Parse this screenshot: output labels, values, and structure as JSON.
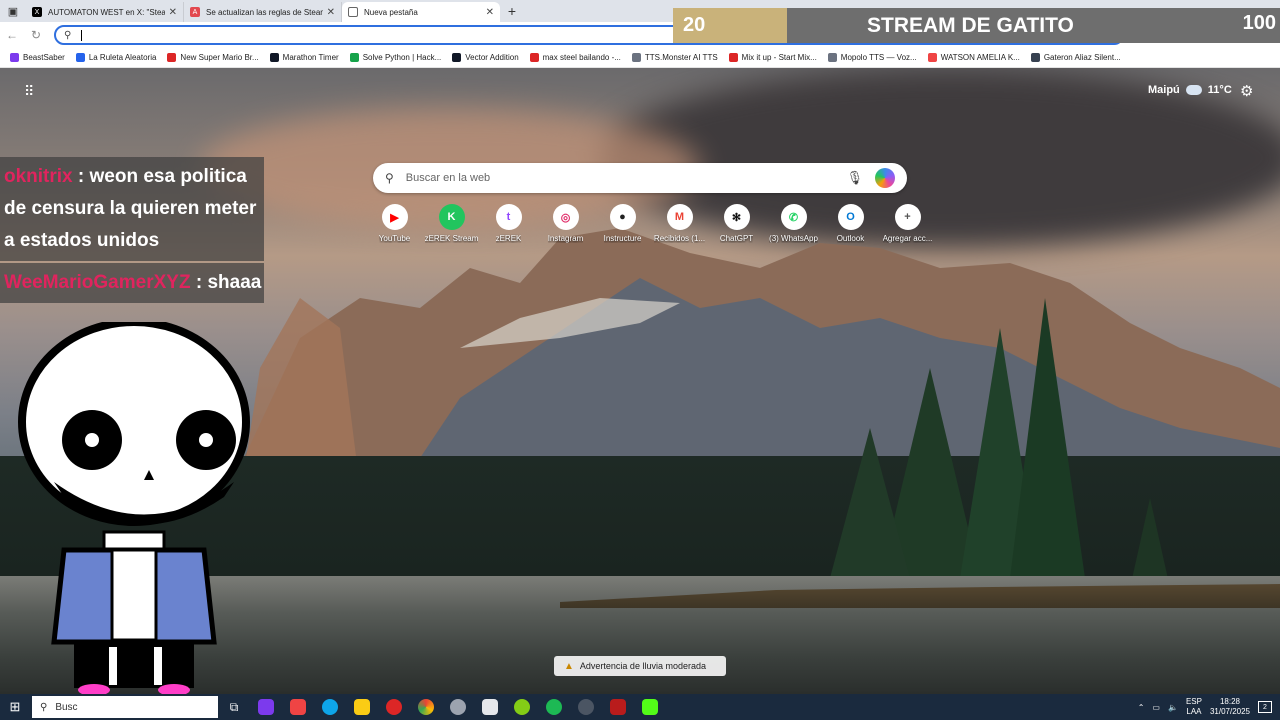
{
  "browser": {
    "tabs": [
      {
        "title": "AUTOMATON WEST en X: \"Steam",
        "color": "#000000",
        "icon": "x-icon"
      },
      {
        "title": "Se actualizan las reglas de Steam",
        "color": "#e2484f",
        "icon": "automaton-icon"
      },
      {
        "title": "Nueva pestaña",
        "color": "#6b7280",
        "icon": "newtab-icon",
        "active": true
      }
    ],
    "new_tab_plus": "+",
    "omnibox_value": ""
  },
  "bookmarks": [
    {
      "label": "BeastSaber",
      "color": "#7c3aed"
    },
    {
      "label": "La Ruleta Aleatoria",
      "color": "#2563eb"
    },
    {
      "label": "New Super Mario Br...",
      "color": "#dc2626"
    },
    {
      "label": "Marathon Timer",
      "color": "#111827"
    },
    {
      "label": "Solve Python | Hack...",
      "color": "#16a34a"
    },
    {
      "label": "Vector Addition",
      "color": "#111827"
    },
    {
      "label": "max steel bailando -...",
      "color": "#dc2626"
    },
    {
      "label": "TTS.Monster AI TTS",
      "color": "#6b7280"
    },
    {
      "label": "Mix it up - Start Mix...",
      "color": "#dc2626"
    },
    {
      "label": "Mopolo TTS — Voz...",
      "color": "#6b7280"
    },
    {
      "label": "WATSON AMELIA K...",
      "color": "#ef4444"
    },
    {
      "label": "Gateron Aliaz Silent...",
      "color": "#374151"
    }
  ],
  "newtab": {
    "weather_city": "Maipú",
    "weather_temp": "11",
    "weather_unit": "°C",
    "search_placeholder": "Buscar en la web",
    "shortcuts": [
      {
        "label": "YouTube",
        "color": "#ff0000",
        "glyph": "▶"
      },
      {
        "label": "zEREK Stream",
        "color": "#22c55e",
        "glyph": "K"
      },
      {
        "label": "zEREK",
        "color": "#9146ff",
        "glyph": "t"
      },
      {
        "label": "Instagram",
        "color": "#e1306c",
        "glyph": "◎"
      },
      {
        "label": "Instructure",
        "color": "#222222",
        "glyph": "●"
      },
      {
        "label": "Recibidos (1...",
        "color": "#ea4335",
        "glyph": "M"
      },
      {
        "label": "ChatGPT",
        "color": "#111111",
        "glyph": "✻"
      },
      {
        "label": "(3) WhatsApp",
        "color": "#25d366",
        "glyph": "✆"
      },
      {
        "label": "Outlook",
        "color": "#0078d4",
        "glyph": "O"
      },
      {
        "label": "Agregar acc...",
        "color": "#555555",
        "glyph": "+"
      }
    ],
    "alert_text": "Advertencia de lluvia moderada"
  },
  "stream": {
    "left_number": "20",
    "title": "STREAM DE GATITO",
    "right_number": "100",
    "chat": [
      {
        "user": "oknitrix",
        "message": ": weon esa politica de censura la quieren meter a estados unidos"
      },
      {
        "user": "WeeMarioGamerXYZ",
        "message": ": shaaa"
      }
    ]
  },
  "taskbar": {
    "search_label": "Busc",
    "lang": "ESP",
    "layout": "LAA",
    "time": "18:28",
    "date": "31/07/2025",
    "notifications": "2",
    "apps": [
      {
        "name": "copilot",
        "color": "#7c3aed"
      },
      {
        "name": "media",
        "color": "#ef4444"
      },
      {
        "name": "edge",
        "color": "#0ea5e9"
      },
      {
        "name": "explorer",
        "color": "#facc15"
      },
      {
        "name": "opera",
        "color": "#dc2626"
      },
      {
        "name": "chrome",
        "color": "#22c55e"
      },
      {
        "name": "shell",
        "color": "#9ca3af"
      },
      {
        "name": "store",
        "color": "#e5e7eb"
      },
      {
        "name": "xbox",
        "color": "#84cc16"
      },
      {
        "name": "spotify",
        "color": "#1db954"
      },
      {
        "name": "steam",
        "color": "#1f2937"
      },
      {
        "name": "game",
        "color": "#b91c1c"
      },
      {
        "name": "kick",
        "color": "#53fc18"
      }
    ]
  }
}
